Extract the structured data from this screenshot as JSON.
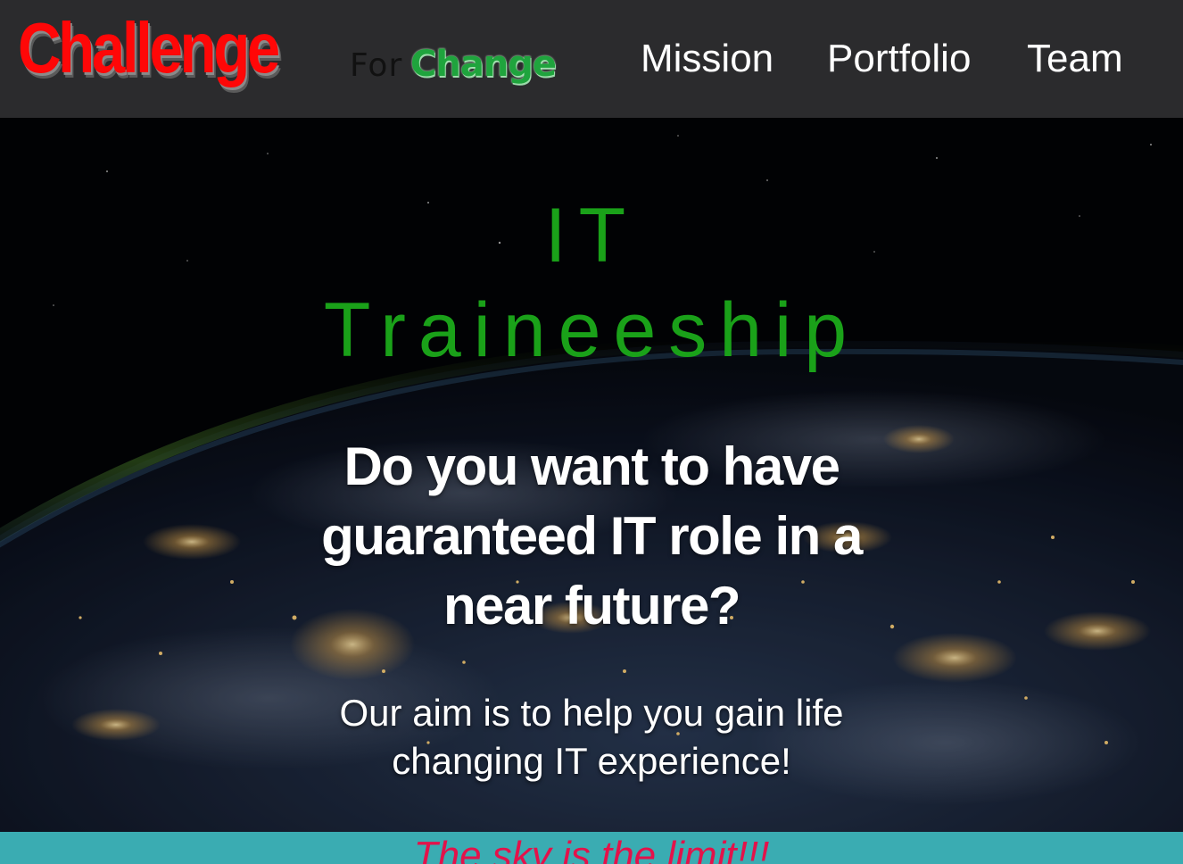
{
  "logo": {
    "part1": "Challenge",
    "part2": "For",
    "part3": "Change",
    "colors": {
      "challenge": "#ff0707",
      "change": "#1fa43d"
    }
  },
  "nav": {
    "items": [
      {
        "label": "Mission"
      },
      {
        "label": "Portfolio"
      },
      {
        "label": "Team"
      }
    ]
  },
  "hero": {
    "title_line1": "IT",
    "title_line2": "Traineeship",
    "question": "Do you want to have guaranteed IT role in a near future?",
    "aim": "Our aim is to help you gain life changing IT experience!",
    "background": "earth-at-night-from-space-image",
    "title_color": "#1aa119"
  },
  "band": {
    "text": "The sky is the limit!!!",
    "background": "#3aacb2",
    "text_color": "#e3124a"
  },
  "colors": {
    "header_bg": "#2b2b2d",
    "nav_text": "#ffffff"
  }
}
